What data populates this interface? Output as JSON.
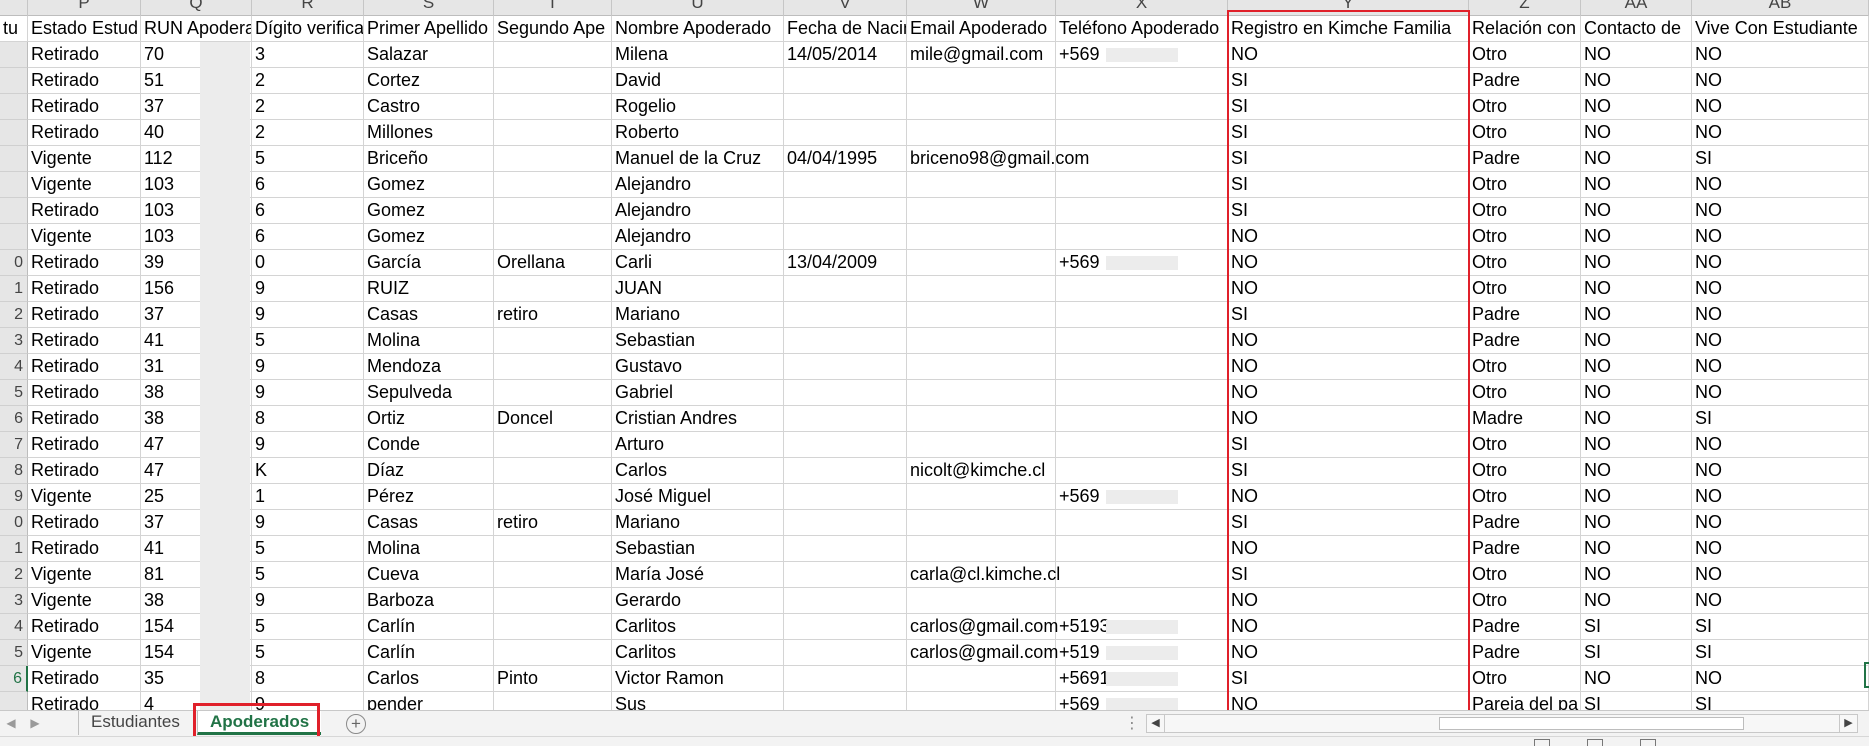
{
  "sheet": {
    "column_letters": [
      {
        "key": "O",
        "text": ""
      },
      {
        "key": "P",
        "text": "P"
      },
      {
        "key": "Q",
        "text": "Q"
      },
      {
        "key": "R",
        "text": "R"
      },
      {
        "key": "S",
        "text": "S"
      },
      {
        "key": "T",
        "text": "T"
      },
      {
        "key": "U",
        "text": "U"
      },
      {
        "key": "V",
        "text": "V"
      },
      {
        "key": "W",
        "text": "W"
      },
      {
        "key": "X",
        "text": "X"
      },
      {
        "key": "Y",
        "text": "Y"
      },
      {
        "key": "Z",
        "text": "Z"
      },
      {
        "key": "AA",
        "text": "AA"
      },
      {
        "key": "AB",
        "text": "AB"
      }
    ],
    "headers": [
      "tu",
      "Estado Estud",
      "RUN Apodera",
      "Dígito verifica",
      "Primer Apellido",
      "Segundo Ape",
      "Nombre Apoderado",
      "Fecha de Nacim",
      "Email Apoderado",
      "Teléfono Apoderado",
      "Registro en Kimche Familia",
      "Relación con",
      "Contacto de",
      "Vive Con Estudiante"
    ],
    "rows": [
      {
        "num": "",
        "cells": [
          "",
          "Retirado",
          "70",
          "3",
          "Salazar",
          "",
          "Milena",
          "14/05/2014",
          "mile@gmail.com",
          "+569",
          "NO",
          "Otro",
          "NO",
          "NO"
        ]
      },
      {
        "num": "",
        "cells": [
          "",
          "Retirado",
          "51",
          "2",
          "Cortez",
          "",
          "David",
          "",
          "",
          "",
          "SI",
          "Padre",
          "NO",
          "NO"
        ]
      },
      {
        "num": "",
        "cells": [
          "",
          "Retirado",
          "37",
          "2",
          "Castro",
          "",
          "Rogelio",
          "",
          "",
          "",
          "SI",
          "Otro",
          "NO",
          "NO"
        ]
      },
      {
        "num": "",
        "cells": [
          "",
          "Retirado",
          "40",
          "2",
          "Millones",
          "",
          "Roberto",
          "",
          "",
          "",
          "SI",
          "Otro",
          "NO",
          "NO"
        ]
      },
      {
        "num": "",
        "cells": [
          "",
          "Vigente",
          "112",
          "5",
          "Briceño",
          "",
          "Manuel de la Cruz",
          "04/04/1995",
          "briceno98@gmail.com",
          "",
          "SI",
          "Padre",
          "NO",
          "SI"
        ]
      },
      {
        "num": "",
        "cells": [
          "",
          "Vigente",
          "103",
          "6",
          "Gomez",
          "",
          "Alejandro",
          "",
          "",
          "",
          "SI",
          "Otro",
          "NO",
          "NO"
        ]
      },
      {
        "num": "",
        "cells": [
          "",
          "Retirado",
          "103",
          "6",
          "Gomez",
          "",
          "Alejandro",
          "",
          "",
          "",
          "SI",
          "Otro",
          "NO",
          "NO"
        ]
      },
      {
        "num": "",
        "cells": [
          "",
          "Vigente",
          "103",
          "6",
          "Gomez",
          "",
          "Alejandro",
          "",
          "",
          "",
          "NO",
          "Otro",
          "NO",
          "NO"
        ]
      },
      {
        "num": "0",
        "cells": [
          "",
          "Retirado",
          "39",
          "0",
          "García",
          "Orellana",
          "Carli",
          "13/04/2009",
          "",
          "+569",
          "NO",
          "Otro",
          "NO",
          "NO"
        ]
      },
      {
        "num": "1",
        "cells": [
          "",
          "Retirado",
          "156",
          "9",
          "RUIZ",
          "",
          "JUAN",
          "",
          "",
          "",
          "NO",
          "Otro",
          "NO",
          "NO"
        ]
      },
      {
        "num": "2",
        "cells": [
          "",
          "Retirado",
          "37",
          "9",
          "Casas",
          "retiro",
          "Mariano",
          "",
          "",
          "",
          "SI",
          "Padre",
          "NO",
          "NO"
        ]
      },
      {
        "num": "3",
        "cells": [
          "",
          "Retirado",
          "41",
          "5",
          "Molina",
          "",
          "Sebastian",
          "",
          "",
          "",
          "NO",
          "Padre",
          "NO",
          "NO"
        ]
      },
      {
        "num": "4",
        "cells": [
          "",
          "Retirado",
          "31",
          "9",
          "Mendoza",
          "",
          "Gustavo",
          "",
          "",
          "",
          "NO",
          "Otro",
          "NO",
          "NO"
        ]
      },
      {
        "num": "5",
        "cells": [
          "",
          "Retirado",
          "38",
          "9",
          "Sepulveda",
          "",
          "Gabriel",
          "",
          "",
          "",
          "NO",
          "Otro",
          "NO",
          "NO"
        ]
      },
      {
        "num": "6",
        "cells": [
          "",
          "Retirado",
          "38",
          "8",
          "Ortiz",
          "Doncel",
          "Cristian Andres",
          "",
          "",
          "",
          "NO",
          "Madre",
          "NO",
          "SI"
        ]
      },
      {
        "num": "7",
        "cells": [
          "",
          "Retirado",
          "47",
          "9",
          "Conde",
          "",
          "Arturo",
          "",
          "",
          "",
          "SI",
          "Otro",
          "NO",
          "NO"
        ]
      },
      {
        "num": "8",
        "cells": [
          "",
          "Retirado",
          "47",
          "K",
          "Díaz",
          "",
          "Carlos",
          "",
          "nicolt@kimche.cl",
          "",
          "SI",
          "Otro",
          "NO",
          "NO"
        ]
      },
      {
        "num": "9",
        "cells": [
          "",
          "Vigente",
          "25",
          "1",
          "Pérez",
          "",
          "José Miguel",
          "",
          "",
          "+569",
          "NO",
          "Otro",
          "NO",
          "NO"
        ]
      },
      {
        "num": "0",
        "cells": [
          "",
          "Retirado",
          "37",
          "9",
          "Casas",
          "retiro",
          "Mariano",
          "",
          "",
          "",
          "SI",
          "Padre",
          "NO",
          "NO"
        ]
      },
      {
        "num": "1",
        "cells": [
          "",
          "Retirado",
          "41",
          "5",
          "Molina",
          "",
          "Sebastian",
          "",
          "",
          "",
          "NO",
          "Padre",
          "NO",
          "NO"
        ]
      },
      {
        "num": "2",
        "cells": [
          "",
          "Vigente",
          "81",
          "5",
          "Cueva",
          "",
          "María José",
          "",
          "carla@cl.kimche.cl",
          "",
          "SI",
          "Otro",
          "NO",
          "NO"
        ]
      },
      {
        "num": "3",
        "cells": [
          "",
          "Vigente",
          "38",
          "9",
          "Barboza",
          "",
          "Gerardo",
          "",
          "",
          "",
          "NO",
          "Otro",
          "NO",
          "NO"
        ]
      },
      {
        "num": "4",
        "cells": [
          "",
          "Retirado",
          "154",
          "5",
          "Carlín",
          "",
          "Carlitos",
          "",
          "carlos@gmail.com",
          "+5193",
          "NO",
          "Padre",
          "SI",
          "SI"
        ]
      },
      {
        "num": "5",
        "cells": [
          "",
          "Vigente",
          "154",
          "5",
          "Carlín",
          "",
          "Carlitos",
          "",
          "carlos@gmail.com",
          "+519",
          "NO",
          "Padre",
          "SI",
          "SI"
        ]
      },
      {
        "num": "6",
        "cells": [
          "",
          "Retirado",
          "35",
          "8",
          "Carlos",
          "Pinto",
          "Victor Ramon",
          "",
          "",
          "+5691",
          "SI",
          "Otro",
          "NO",
          "NO"
        ]
      },
      {
        "num": "",
        "cells": [
          "",
          "Retirado",
          "4",
          "9",
          "pender",
          "",
          "Sus",
          "",
          "",
          "+569",
          "NO",
          "Pareja del pa",
          "SI",
          "SI"
        ]
      }
    ],
    "active_row_index": 24
  },
  "tabs": [
    {
      "label": "Estudiantes",
      "active": false
    },
    {
      "label": "Apoderados",
      "active": true
    }
  ],
  "bottom_bar": {
    "nav_prev": "◀",
    "nav_next": "▶",
    "add_sheet": "+",
    "more": "⋮",
    "scroll_left": "◀",
    "scroll_right": "▶"
  },
  "colors": {
    "accent": "#217346",
    "highlight": "#e0202a",
    "redaction": "#ececec"
  }
}
